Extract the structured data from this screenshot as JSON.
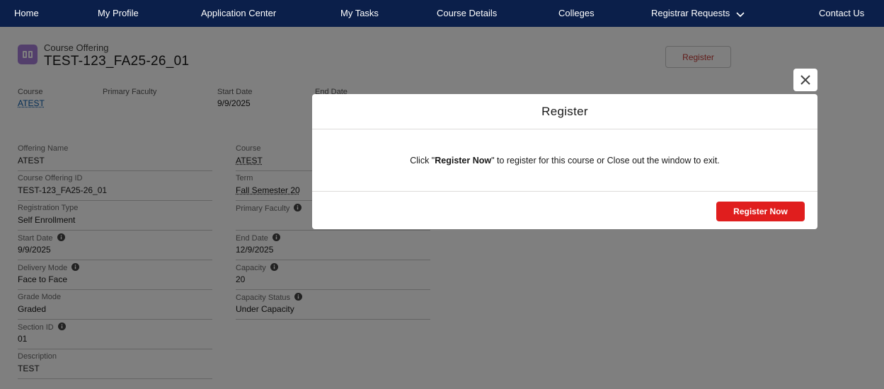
{
  "nav": {
    "items": [
      "Home",
      "My Profile",
      "Application Center",
      "My Tasks",
      "Course Details",
      "Colleges",
      "Registrar Requests",
      "Contact Us"
    ]
  },
  "record": {
    "object_type": "Course Offering",
    "title": "TEST-123_FA25-26_01",
    "register_label": "Register",
    "highlights": {
      "course_label": "Course",
      "course_value": "ATEST",
      "primary_faculty_label": "Primary Faculty",
      "start_date_label": "Start Date",
      "start_date_value": "9/9/2025",
      "end_date_label": "End Date"
    }
  },
  "details": {
    "left": [
      {
        "label": "Offering Name",
        "value": "ATEST",
        "info": false
      },
      {
        "label": "Course Offering ID",
        "value": "TEST-123_FA25-26_01",
        "info": false
      },
      {
        "label": "Registration Type",
        "value": "Self Enrollment",
        "info": false
      },
      {
        "label": "Start Date",
        "value": "9/9/2025",
        "info": true
      },
      {
        "label": "Delivery Mode",
        "value": "Face to Face",
        "info": true
      },
      {
        "label": "Grade Mode",
        "value": "Graded",
        "info": false
      },
      {
        "label": "Section ID",
        "value": "01",
        "info": true
      },
      {
        "label": "Description",
        "value": "TEST",
        "info": false
      }
    ],
    "right": [
      {
        "label": "Course",
        "value": "ATEST",
        "info": false
      },
      {
        "label": "Term",
        "value": "Fall Semester 20",
        "info": false
      },
      {
        "label": "Primary Faculty",
        "value": "",
        "info": true
      },
      {
        "label": "End Date",
        "value": "12/9/2025",
        "info": true
      },
      {
        "label": "Capacity",
        "value": "20",
        "info": true
      },
      {
        "label": "Capacity Status",
        "value": "Under Capacity",
        "info": true
      }
    ]
  },
  "modal": {
    "title": "Register",
    "body_prefix": "Click \"",
    "body_bold": "Register Now",
    "body_suffix": "\" to register for this course or Close out the window to exit.",
    "primary_button": "Register Now"
  },
  "colors": {
    "nav_bg": "#0b1f4a",
    "brand_red": "#e01e1e",
    "icon_purple": "#a77ed8",
    "link": "#0b5cab"
  }
}
